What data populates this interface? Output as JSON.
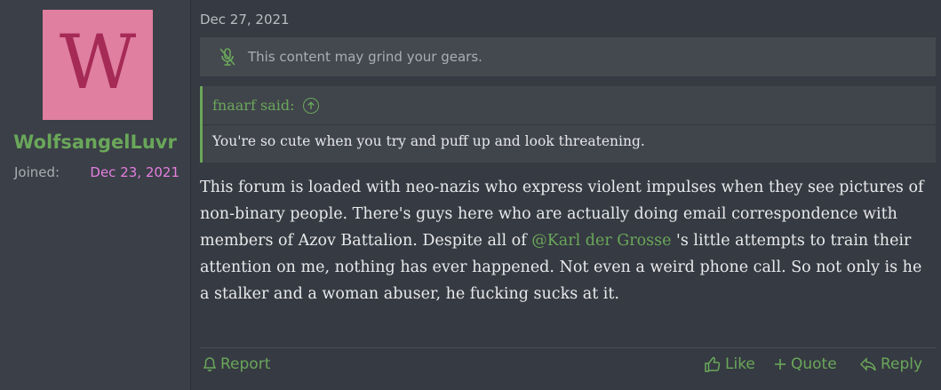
{
  "user": {
    "avatar_letter": "W",
    "avatar_color": "#e07fa0",
    "username": "WolfsangelLuvr",
    "joined_label": "Joined:",
    "joined_date": "Dec 23, 2021"
  },
  "post": {
    "date": "Dec 27, 2021",
    "warning_text": "This content may grind your gears.",
    "quote": {
      "author_said": "fnaarf said:",
      "text": "You're so cute when you try and puff up and look threatening."
    },
    "message": {
      "part1": "This forum is loaded with neo-nazis who express violent impulses when they see pictures of non-binary people. There's guys here who are actually doing email correspondence with members of Azov Battalion. Despite all of ",
      "mention": "@Karl der Grosse",
      "part2": " 's little attempts to train their attention on me, nothing has ever happened. Not even a weird phone call. So not only is he a stalker and a woman abuser, he fucking sucks at it."
    }
  },
  "actions": {
    "report": "Report",
    "like": "Like",
    "quote": "Quote",
    "reply": "Reply"
  },
  "colors": {
    "accent": "#6aa75a",
    "joined_date": "#e57fe0",
    "background": "#363a42"
  }
}
